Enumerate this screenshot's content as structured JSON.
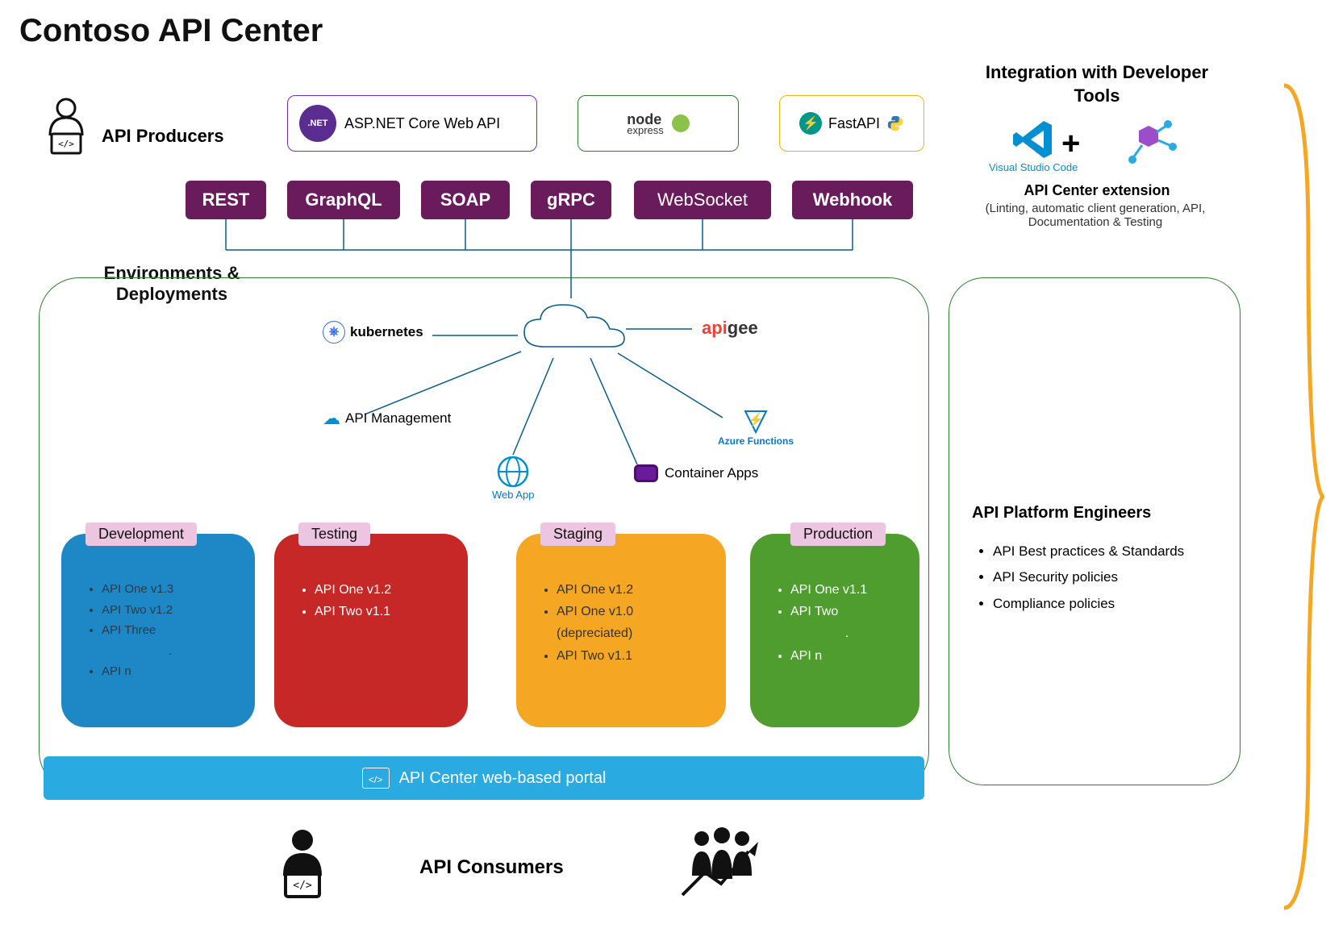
{
  "title": "Contoso API Center",
  "producers": {
    "label": "API Producers",
    "frameworks": {
      "aspnet": {
        "label": "ASP.NET Core Web API",
        "badge": ".NET Core"
      },
      "node": {
        "label": "node",
        "sub": "express"
      },
      "fastapi": {
        "label": "FastAPI"
      }
    }
  },
  "api_types": [
    "REST",
    "GraphQL",
    "SOAP",
    "gRPC",
    "WebSocket",
    "Webhook"
  ],
  "environments": {
    "heading": "Environments & Deployments",
    "services": {
      "kubernetes": "kubernetes",
      "apigee": "apigee",
      "apim": "API Management",
      "azfn": "Azure Functions",
      "webapp": "Web App",
      "capps": "Container Apps"
    },
    "cards": {
      "development": {
        "tag": "Development",
        "items": [
          "API One v1.3",
          "API Two v1.2",
          "API Three",
          ".",
          "API n"
        ]
      },
      "testing": {
        "tag": "Testing",
        "items": [
          "API One v1.2",
          "API Two v1.1"
        ]
      },
      "staging": {
        "tag": "Staging",
        "items": [
          "API One v1.2",
          "API One v1.0 (depreciated)",
          "API Two v1.1"
        ]
      },
      "production": {
        "tag": "Production",
        "items": [
          "API One v1.1",
          "API Two",
          ".",
          "API n"
        ]
      }
    }
  },
  "portal": {
    "label": "API Center web-based portal"
  },
  "consumers": {
    "label": "API Consumers"
  },
  "integration": {
    "title": "Integration with Developer Tools",
    "vscode": "Visual Studio Code",
    "ext_title": "API Center extension",
    "ext_sub": "(Linting, automatic client generation, API, Documentation & Testing"
  },
  "platform_engineers": {
    "title": "API Platform Engineers",
    "items": [
      "API Best practices & Standards",
      "API Security policies",
      "Compliance policies"
    ]
  }
}
